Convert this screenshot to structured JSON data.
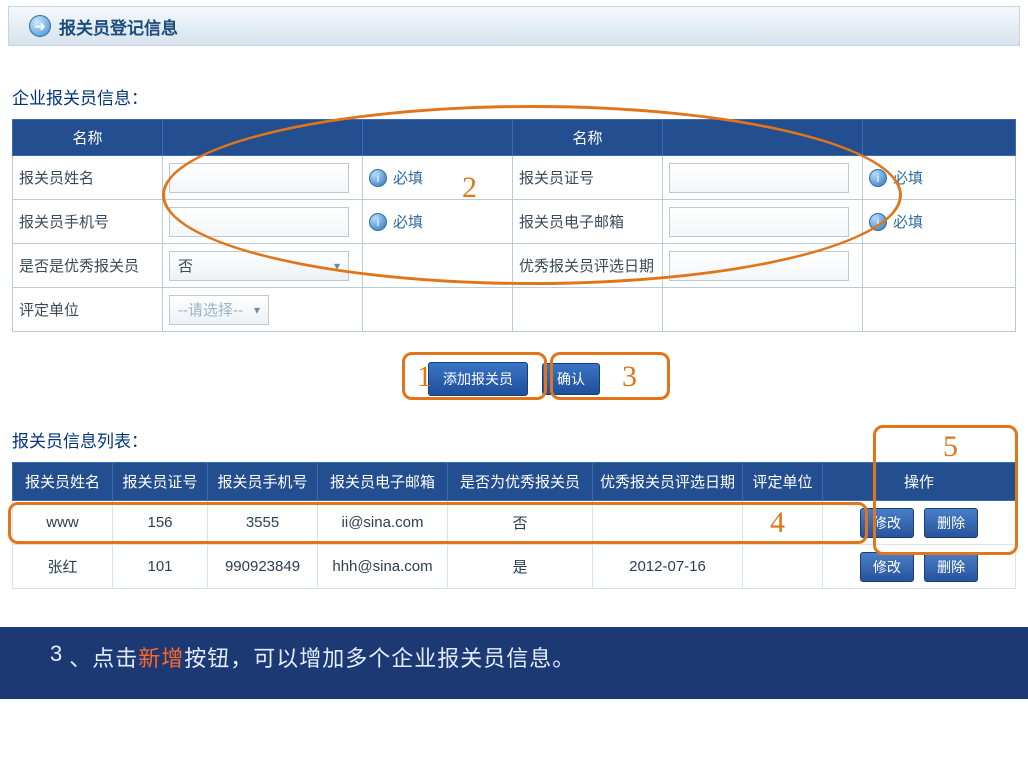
{
  "header": {
    "title": "报关员登记信息"
  },
  "form": {
    "section_title": "企业报关员信息：",
    "head_col1": "名称",
    "head_col2": "名称",
    "rows": {
      "name_label": "报关员姓名",
      "name_req": "必填",
      "cert_label": "报关员证号",
      "cert_req": "必填",
      "phone_label": "报关员手机号",
      "phone_req": "必填",
      "email_label": "报关员电子邮箱",
      "email_req": "必填",
      "excellent_label": "是否是优秀报关员",
      "excellent_value": "否",
      "award_date_label": "优秀报关员评选日期",
      "unit_label": "评定单位",
      "unit_placeholder": "--请选择--"
    },
    "btn_add": "添加报关员",
    "btn_confirm": "确认"
  },
  "list": {
    "section_title": "报关员信息列表：",
    "cols": {
      "name": "报关员姓名",
      "cert": "报关员证号",
      "phone": "报关员手机号",
      "email": "报关员电子邮箱",
      "excellent": "是否为优秀报关员",
      "award_date": "优秀报关员评选日期",
      "unit": "评定单位",
      "ops": "操作"
    },
    "rows": [
      {
        "name": "www",
        "cert": "156",
        "phone": "3555",
        "email": "ii@sina.com",
        "excellent": "否",
        "award_date": "",
        "unit": ""
      },
      {
        "name": "张红",
        "cert": "101",
        "phone": "990923849",
        "email": "hhh@sina.com",
        "excellent": "是",
        "award_date": "2012-07-16",
        "unit": ""
      }
    ],
    "btn_edit": "修改",
    "btn_delete": "删除"
  },
  "annotations": {
    "n1": "1",
    "n2": "2",
    "n3": "3",
    "n4": "4",
    "n5": "5"
  },
  "footer": {
    "num": "3",
    "pre": "、点击",
    "kw": "新增",
    "post": "按钮，可以增加多个企业报关员信息。"
  }
}
